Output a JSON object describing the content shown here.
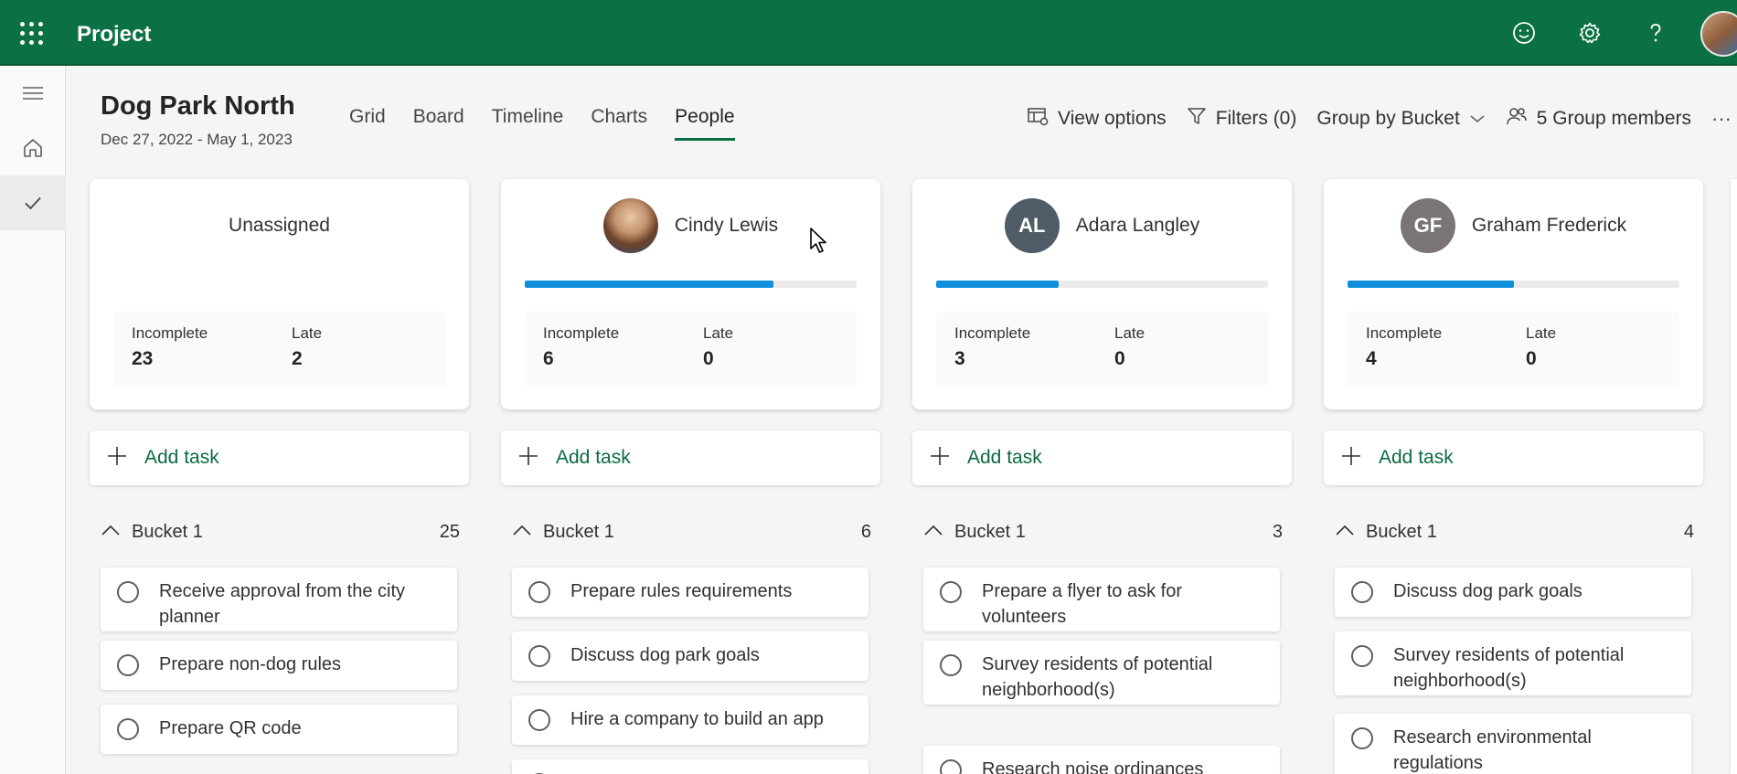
{
  "app": {
    "title": "Project"
  },
  "plan": {
    "title": "Dog Park North",
    "dates": "Dec 27, 2022 - May 1, 2023"
  },
  "tabs": [
    {
      "label": "Grid"
    },
    {
      "label": "Board"
    },
    {
      "label": "Timeline"
    },
    {
      "label": "Charts"
    },
    {
      "label": "People",
      "active": true
    }
  ],
  "toolbar": {
    "view_options": "View options",
    "filters": "Filters (0)",
    "group_by": "Group by Bucket",
    "group_members": "5 Group members",
    "more": "···"
  },
  "stat_labels": {
    "incomplete": "Incomplete",
    "late": "Late"
  },
  "add_task_label": "Add task",
  "columns": [
    {
      "name": "Unassigned",
      "incomplete": "23",
      "late": "2",
      "bucket": {
        "name": "Bucket 1",
        "count": "25"
      },
      "tasks": [
        "Receive approval from the city planner",
        "Prepare non-dog rules",
        "Prepare QR code"
      ]
    },
    {
      "name": "Cindy Lewis",
      "avatar": "photo",
      "progress": 0.75,
      "incomplete": "6",
      "late": "0",
      "bucket": {
        "name": "Bucket 1",
        "count": "6"
      },
      "tasks": [
        "Prepare rules requirements",
        "Discuss dog park goals",
        "Hire a company to build an app"
      ]
    },
    {
      "name": "Adara Langley",
      "initials": "AL",
      "avatar_color": "#4f5b66",
      "progress": 0.37,
      "incomplete": "3",
      "late": "0",
      "bucket": {
        "name": "Bucket 1",
        "count": "3"
      },
      "tasks": [
        "Prepare a flyer to ask for volunteers",
        "Survey residents of potential neighborhood(s)",
        "Research noise ordinances"
      ]
    },
    {
      "name": "Graham Frederick",
      "initials": "GF",
      "avatar_color": "#7a7574",
      "progress": 0.5,
      "incomplete": "4",
      "late": "0",
      "bucket": {
        "name": "Bucket 1",
        "count": "4"
      },
      "tasks": [
        "Discuss dog park goals",
        "Survey residents of potential neighborhood(s)",
        "Research environmental regulations"
      ]
    }
  ],
  "colors": {
    "brand": "#0b7043",
    "progress": "#0f8fdc",
    "add_task": "#0b6a40"
  },
  "icons": [
    "app-launcher-icon",
    "smiley-icon",
    "settings-icon",
    "help-icon",
    "hamburger-icon",
    "home-icon",
    "checkmark-icon",
    "view-options-icon",
    "filter-icon",
    "chevron-down-icon",
    "group-members-icon",
    "plus-icon",
    "chevron-up-icon"
  ]
}
